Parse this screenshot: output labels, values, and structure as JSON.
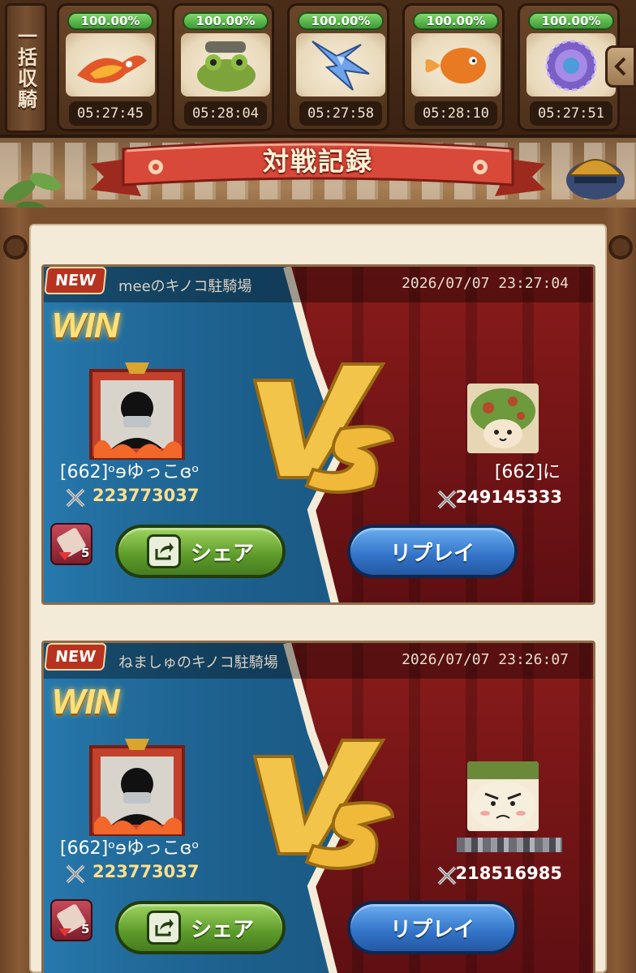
{
  "collect_button": {
    "label": "一括収騎"
  },
  "mount_slots": [
    {
      "percent": "100.00%",
      "time": "05:27:45",
      "icon": "fire-bird-mount-icon"
    },
    {
      "percent": "100.00%",
      "time": "05:28:04",
      "icon": "frog-cannon-mount-icon"
    },
    {
      "percent": "100.00%",
      "time": "05:27:58",
      "icon": "crystal-dragon-mount-icon"
    },
    {
      "percent": "100.00%",
      "time": "05:28:10",
      "icon": "goldfish-mount-icon"
    },
    {
      "percent": "100.00%",
      "time": "05:27:51",
      "icon": "magic-portal-mount-icon"
    }
  ],
  "banner": {
    "title": "対戦記録"
  },
  "battles": [
    {
      "badge": "NEW",
      "location": "meeのキノコ駐騎場",
      "timestamp": "2026/07/07 23:27:04",
      "result": "WIN",
      "player": {
        "name": "[662]ᵒɘゆっこɞᵒ",
        "power": "223773037"
      },
      "opponent": {
        "name": "[662]に",
        "power": "249145333",
        "avatar": "green-mushroom-avatar-icon"
      },
      "rank_change": "5",
      "share_label": "シェア",
      "replay_label": "リプレイ"
    },
    {
      "badge": "NEW",
      "location": "ねましゅのキノコ駐騎場",
      "timestamp": "2026/07/07 23:26:07",
      "result": "WIN",
      "player": {
        "name": "[662]ᵒɘゆっこɞᵒ",
        "power": "223773037"
      },
      "opponent": {
        "name": "",
        "power": "218516985",
        "avatar": "angry-mushroom-avatar-icon"
      },
      "rank_change": "5",
      "share_label": "シェア",
      "replay_label": "リプレイ"
    }
  ],
  "colors": {
    "win_gold": "#ffe07a",
    "left_blue": "#2a7aa8",
    "right_red": "#8a1b1b",
    "share_green": "#5c9a2a",
    "replay_blue": "#3273c8"
  }
}
